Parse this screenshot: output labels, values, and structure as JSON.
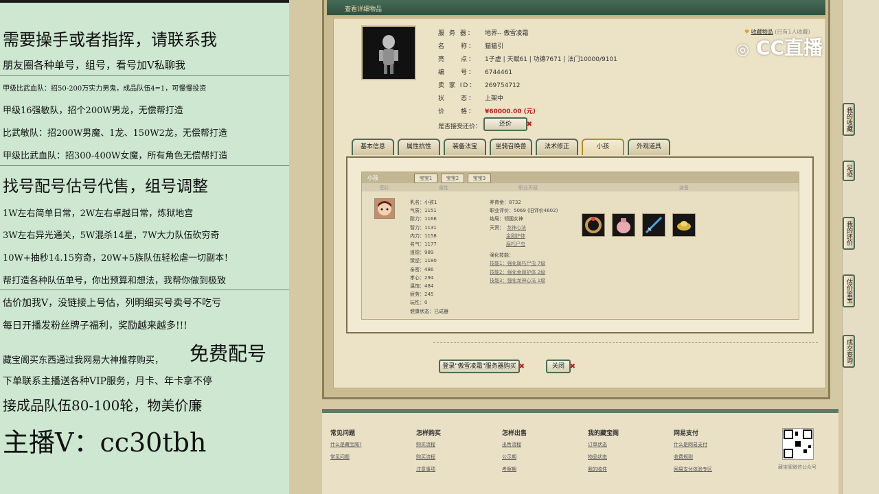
{
  "promo": {
    "lines": [
      "需要操手或者指挥，请联系我",
      "朋友圈各种单号，组号，看号加V私聊我",
      "甲级比武血队：招50-200万实力男鬼，成品队伍4=1，可慢慢投资",
      "甲级16强敏队，招个200W男龙，无偿帮打造",
      "比武敏队：招200W男魔、1龙、150W2龙，无偿帮打造",
      "甲级比武血队：招300-400W女魔，所有角色无偿帮打造",
      "找号配号估号代售，组号调整",
      "1W左右简单日常，2W左右卓越日常，炼狱地宫",
      "3W左右异光通关，5W混杀14星，7W大力队伍砍穷奇",
      "10W+抽秒14.15穷奇，20W+5族队伍轻松虐一切副本！",
      "帮打造各种队伍单号，你出预算和想法，我帮你做到极致",
      "估价加我V，没链接上号估，列明细买号卖号不吃亏",
      "每日开播发粉丝牌子福利，奖励越来越多!!!",
      "藏宝阁买东西通过我网易大神推荐购买，",
      "免费配号",
      "下单联系主播送各种VIP服务，月卡、年卡拿不停",
      "接成品队伍80-100轮，物美价廉",
      "主播V：cc30tbh"
    ]
  },
  "window": {
    "title": "查看详细物品"
  },
  "info": {
    "server_label": "服 务 器：",
    "server": "地界-- 傲雪凌霜",
    "name_label": "名　　称：",
    "name": "猫猫引",
    "highlight_label": "亮　　点：",
    "highlight": "1子虚 | 天赋61 | 功德7671 | 法门10000/9101",
    "id_label": "编　　号：",
    "id": "6744461",
    "seller_label": "卖 家 ID：",
    "seller": "269754712",
    "status_label": "状　　态：",
    "status": "上架中",
    "price_label": "价　　格：",
    "price": "¥60000.00 (元)",
    "bargain_label": "是否接受还价：",
    "bargain_button": "还价",
    "fav_text": "收藏物品",
    "fav_count": "(已有1人收藏)"
  },
  "tabs": [
    "基本信息",
    "属性抗性",
    "装备法宝",
    "坐骑召唤兽",
    "法术修正",
    "小孩",
    "外观道具"
  ],
  "child": {
    "panel_label": "小孩",
    "subtabs": [
      "宝宝1",
      "宝宝2",
      "宝宝3"
    ],
    "col_image": "图片",
    "col_attr": "属性",
    "col_talent": "职业天赋",
    "col_equip": "装备",
    "stats": [
      "乳名：小孩1",
      "气质：1151",
      "耐力：1166",
      "智力：1131",
      "内力：1158",
      "名气：1177",
      "道德：989",
      "叛逆：1180",
      "亲密：486",
      "孝心：294",
      "温饱：484",
      "疲劳：245",
      "玩性：0",
      "健康状态：已成器"
    ],
    "nurture": "养育金：8732",
    "job_score": "职业评价：5069 (旧评价4602)",
    "result": "结局：领国女神",
    "talent_label": "天资：",
    "talents": [
      "龙神心法",
      "金刚护体",
      "腐朽尸虫"
    ],
    "skills_label": "强化技能：",
    "skills": [
      "技能1：强化腐朽尸虫 7级",
      "技能2：强化金刚护体 2级",
      "技能3：强化龙神心法 1级"
    ]
  },
  "actions": {
    "login_button": "登录\"傲雪凌霜\"服务器购买",
    "close_button": "关闭"
  },
  "footer": {
    "cols": [
      {
        "h": "常见问题",
        "items": [
          "什么是藏宝阁?",
          "常见问题"
        ]
      },
      {
        "h": "怎样购买",
        "items": [
          "购买流程",
          "购买流程",
          "注意事项"
        ]
      },
      {
        "h": "怎样出售",
        "items": [
          "出售流程",
          "公示期",
          "考察期"
        ]
      },
      {
        "h": "我的藏宝阁",
        "items": [
          "订单状态",
          "物品状态",
          "我的收件"
        ]
      },
      {
        "h": "网易支付",
        "items": [
          "什么是网易支付",
          "收费规则",
          "网易支付体验专区"
        ]
      }
    ],
    "qr_caption": "藏宝阁微信公众号"
  },
  "sidebar": [
    "我的收藏",
    "足迹",
    "我的还价",
    "估价鉴宝",
    "成交查询"
  ],
  "logo": "CC直播",
  "colors": {
    "accent_green": "#4c6a55",
    "price_red": "#b81c1c",
    "promo_bg": "#cde7d1"
  }
}
